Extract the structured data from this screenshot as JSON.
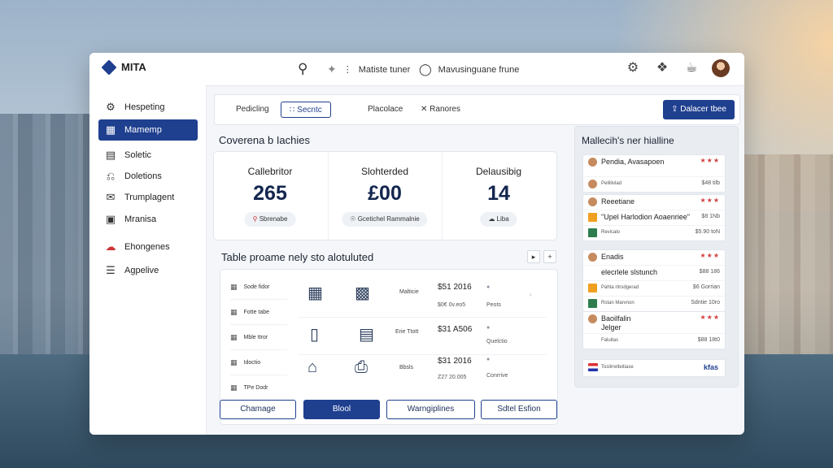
{
  "app": {
    "brand": "MITA",
    "brand_sub": ""
  },
  "topbar": {
    "tool_a": "Matiste tuner",
    "tool_b": "Mavusinguane frune",
    "icons": [
      "settings-gear-icon",
      "cube-icon",
      "bag-icon"
    ]
  },
  "sidebar": {
    "items": [
      {
        "label": "Hespeting",
        "icon": "gear-icon"
      },
      {
        "label": "Mamemp",
        "icon": "grid-icon",
        "active": true
      },
      {
        "label": "Soletic",
        "icon": "doc-icon"
      },
      {
        "label": "Doletions",
        "icon": "lock-icon"
      },
      {
        "label": "Trumplagent",
        "icon": "chat-icon"
      },
      {
        "label": "Mranisa",
        "icon": "image-icon"
      },
      {
        "label": "Ehongenes",
        "icon": "cloud-icon"
      },
      {
        "label": "Agpelive",
        "icon": "list-icon"
      }
    ]
  },
  "tabs": {
    "items": [
      "Pedicling",
      "Secntc",
      "Placolace",
      "Ranores"
    ],
    "selected": 1,
    "primary_button": "Dalacer tbee"
  },
  "stats": {
    "title": "Coverena b Iachies",
    "items": [
      {
        "label": "Callebritor",
        "value": "265",
        "chip": "Sbrenabe"
      },
      {
        "label": "Slohterded",
        "value": "£00",
        "chip": "Gcetichel Rammalnie"
      },
      {
        "label": "Delausibig",
        "value": "14",
        "chip": "Liba"
      }
    ]
  },
  "table": {
    "title": "Table proame nely sto alotuluted",
    "row_labels": [
      "Sode fidor",
      "Fotte tabe",
      "Mble ttror",
      "Idoctio",
      "TPe Dodr"
    ],
    "rows": [
      {
        "name": "Malticie",
        "price": "$51 2016",
        "sub": "$0€ 0v.eo5",
        "dot_label": "Peots"
      },
      {
        "name": "Erie Ttott",
        "price": "$31 A506",
        "sub": "",
        "dot_label": "Quelctio"
      },
      {
        "name": "Bbsls",
        "price": "$31 2016",
        "sub": "Z27 20.005",
        "dot_label": "Conrrive"
      }
    ],
    "buttons": [
      "Chamage",
      "Blool",
      "Warngiplines",
      "Sdtel Esfion"
    ]
  },
  "right_panel": {
    "title": "Mallecih's ner hialline",
    "cards": [
      {
        "lines": [
          {
            "name": "Pendia, Avasapoen",
            "price": "★★★",
            "red": true,
            "icon": "avatar"
          },
          {
            "name": "Pellilivlad",
            "price": "$48 tilb",
            "small": true,
            "icon": "avatar"
          }
        ]
      },
      {
        "lines": [
          {
            "name": "Reeetiane",
            "price": "★★★",
            "red": true,
            "icon": "avatar"
          },
          {
            "name": "\"Upel Harlodion Aoaenriee\"",
            "price": "$8 1Nb",
            "icon": "bolt"
          },
          {
            "name": "Revicalo",
            "price": "$5.90 toN",
            "small": true,
            "icon": "tag"
          }
        ]
      },
      {
        "lines": [
          {
            "name": "Enadis",
            "price": "★★★",
            "red": true,
            "icon": "avatar"
          },
          {
            "name": "elecrlele slstunch",
            "price": "$88 186",
            "icon": "none"
          },
          {
            "name": "Pahta ritrsdgerad",
            "price": "$6 Gorrian",
            "small": true,
            "icon": "bolt"
          },
          {
            "name": "Rstan Marvnon",
            "price": "Sdntie 10ro",
            "small": true,
            "icon": "tag"
          }
        ]
      },
      {
        "lines": [
          {
            "name": "Baoilfalin Jelger",
            "price": "★★★",
            "red": true,
            "icon": "avatar"
          },
          {
            "name": "Faluitas",
            "price": "$88 18t0",
            "small": true,
            "icon": "none"
          }
        ]
      }
    ],
    "footer_text": "Toslirrelteitiase",
    "footer_link": "kfas"
  }
}
